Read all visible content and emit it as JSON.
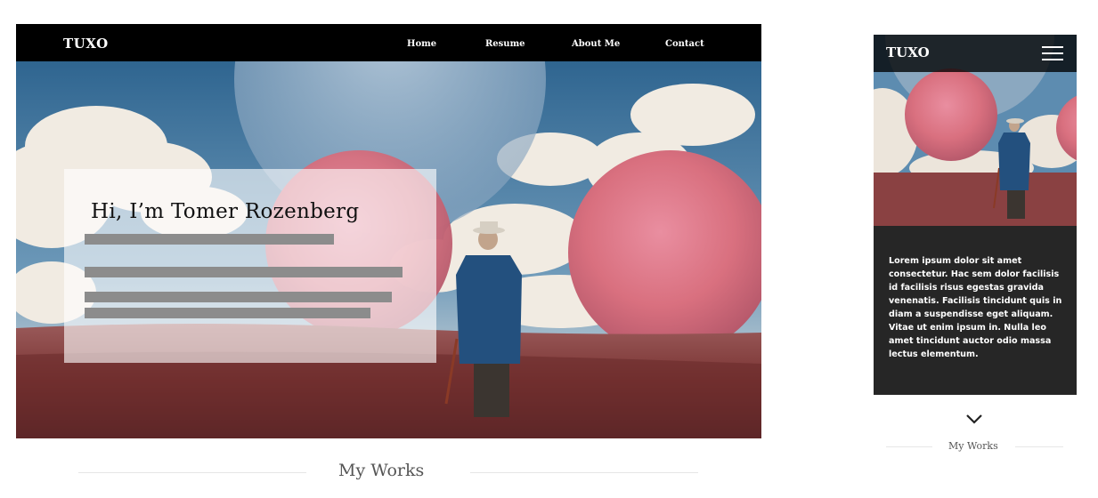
{
  "brand": {
    "logo": "TUXO"
  },
  "desktop": {
    "nav": [
      {
        "label": "Home"
      },
      {
        "label": "Resume"
      },
      {
        "label": "About Me"
      },
      {
        "label": "Contact"
      }
    ],
    "hero": {
      "title": "Hi, I’m Tomer Rozenberg"
    },
    "works_label": "My Works"
  },
  "mobile": {
    "logo": "TUXO",
    "menu_icon": "hamburger-icon",
    "intro": "Lorem ipsum dolor sit amet consectetur. Hac sem dolor facilisis id facilisis risus egestas gravida venenatis. Facilisis tincidunt quis in diam a suspendisse eget aliquam. Vitae ut enim ipsum in. Nulla leo amet tincidunt auctor odio massa lectus elementum.",
    "scroll_icon": "chevron-down-icon",
    "works_label": "My Works"
  },
  "colors": {
    "nav_bg": "#000000",
    "mobile_panel_bg": "#262626",
    "sky": "#3f78a6",
    "sphere_pink": "#e0707c",
    "field": "#7a3a36",
    "coat": "#23507e"
  }
}
